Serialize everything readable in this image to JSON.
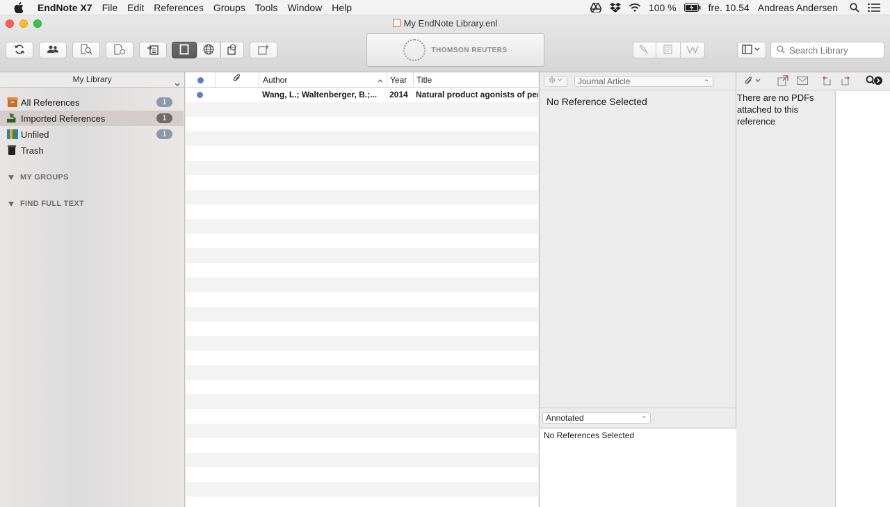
{
  "menubar": {
    "app_name": "EndNote X7",
    "menus": [
      "File",
      "Edit",
      "References",
      "Groups",
      "Tools",
      "Window",
      "Help"
    ],
    "battery": "100 %",
    "clock": "fre. 10.54",
    "user": "Andreas Andersen"
  },
  "window": {
    "title": "My EndNote Library.enl",
    "brand": "THOMSON REUTERS",
    "search_placeholder": "Search Library"
  },
  "sidebar": {
    "header": "My Library",
    "items": [
      {
        "label": "All References",
        "count": "1",
        "icon": "box-icon"
      },
      {
        "label": "Imported References",
        "count": "1",
        "icon": "import-arrow-icon"
      },
      {
        "label": "Unfiled",
        "count": "1",
        "icon": "books-icon"
      },
      {
        "label": "Trash",
        "count": "",
        "icon": "trash-icon"
      }
    ],
    "sections": [
      "MY GROUPS",
      "FIND FULL TEXT"
    ]
  },
  "reflist": {
    "columns": {
      "author": "Author",
      "year": "Year",
      "title": "Title"
    },
    "rows": [
      {
        "author": "Wang, L.; Waltenberger, B.;...",
        "year": "2014",
        "title": "Natural product agonists of peroxisome proliferator-activated receptor gamma"
      }
    ]
  },
  "preview": {
    "ref_type": "Journal Article",
    "message": "No Reference Selected",
    "style": "Annotated",
    "style_message": "No References Selected"
  },
  "pdf": {
    "message": "There are no PDFs attached to this reference"
  },
  "colors": {
    "accent_dot": "#5b7ec7",
    "count_badge": "#8c97ad"
  }
}
